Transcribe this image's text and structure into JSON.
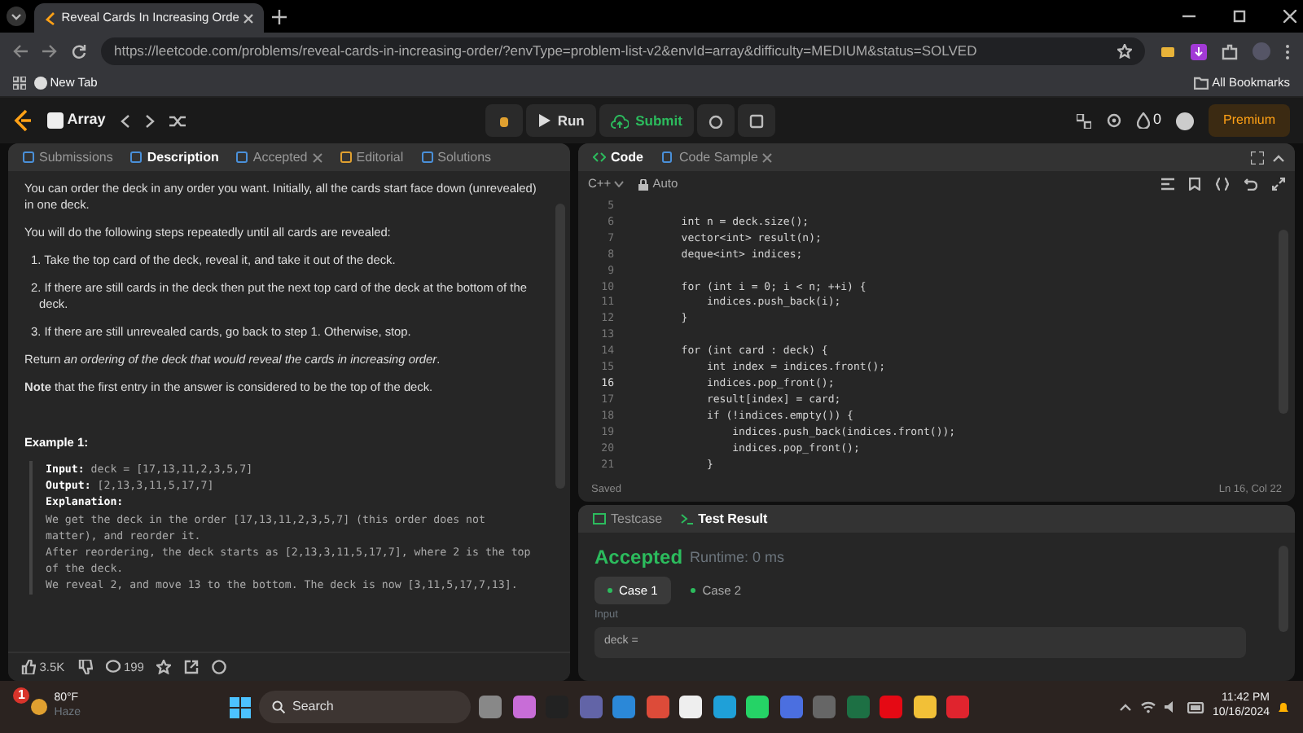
{
  "browser": {
    "tab_title": "Reveal Cards In Increasing Orde",
    "url": "https://leetcode.com/problems/reveal-cards-in-increasing-order/?envType=problem-list-v2&envId=array&difficulty=MEDIUM&status=SOLVED",
    "bookmarks": [
      "New Tab"
    ],
    "all_bookmarks": "All Bookmarks"
  },
  "header": {
    "problem_list": "Array",
    "run": "Run",
    "submit": "Submit",
    "streak": "0",
    "premium": "Premium"
  },
  "left_tabs": [
    {
      "label": "Submissions",
      "selected": false
    },
    {
      "label": "Description",
      "selected": true
    },
    {
      "label": "Accepted",
      "selected": false,
      "closable": true
    },
    {
      "label": "Editorial",
      "selected": false
    },
    {
      "label": "Solutions",
      "selected": false
    }
  ],
  "description": [
    {
      "kind": "p",
      "text": "You can order the deck in any order you want. Initially, all the cards start face down (unrevealed) in one deck."
    },
    {
      "kind": "p",
      "text": "You will do the following steps repeatedly until all cards are revealed:"
    },
    {
      "kind": "li",
      "text": "1. Take the top card of the deck, reveal it, and take it out of the deck."
    },
    {
      "kind": "li",
      "text": "2. If there are still cards in the deck then put the next top card of the deck at the bottom of the deck."
    },
    {
      "kind": "li",
      "text": "3. If there are still unrevealed cards, go back to step 1. Otherwise, stop."
    },
    {
      "kind": "p",
      "text": "Return *an ordering of the deck that would reveal the cards in increasing order*."
    },
    {
      "kind": "p",
      "text": "**Note** that the first entry in the answer is considered to be the top of the deck."
    }
  ],
  "example": {
    "title": "Example 1:",
    "lines": [
      "**Input:** deck = [17,13,11,2,3,5,7]",
      "**Output:** [2,13,3,11,5,17,7]",
      "**Explanation:**",
      "We get the deck in the order [17,13,11,2,3,5,7] (this order does not matter), and reorder it.",
      "After reordering, the deck starts as [2,13,3,11,5,17,7], where 2 is the top of the deck.",
      "We reveal 2, and move 13 to the bottom.  The deck is now [3,11,5,17,7,13]."
    ]
  },
  "left_footer": {
    "likes": "3.5K",
    "comments": "199"
  },
  "code_tabs": [
    {
      "label": "Code",
      "selected": true
    },
    {
      "label": "Code Sample",
      "selected": false,
      "closable": true
    }
  ],
  "editor": {
    "language": "C++",
    "mode": "Auto",
    "lines": [
      {
        "n": "5",
        "current": false
      },
      {
        "n": "6",
        "code": "        int n = deck.size();",
        "current": false
      },
      {
        "n": "7",
        "code": "        vector<int> result(n);",
        "current": false
      },
      {
        "n": "8",
        "code": "        deque<int> indices;",
        "current": false
      },
      {
        "n": "9",
        "current": false
      },
      {
        "n": "10",
        "code": "        for (int i = 0; i < n; ++i) {",
        "current": false
      },
      {
        "n": "11",
        "code": "            indices.push_back(i);",
        "current": false
      },
      {
        "n": "12",
        "code": "        }",
        "current": false
      },
      {
        "n": "13",
        "current": false
      },
      {
        "n": "14",
        "code": "        for (int card : deck) {",
        "current": false
      },
      {
        "n": "15",
        "code": "            int index = indices.front();",
        "current": false
      },
      {
        "n": "16",
        "code": "            indices.pop_front();",
        "current": true
      },
      {
        "n": "17",
        "code": "            result[index] = card;",
        "current": false
      },
      {
        "n": "18",
        "code": "            if (!indices.empty()) {",
        "current": false
      },
      {
        "n": "19",
        "code": "                indices.push_back(indices.front());",
        "current": false
      },
      {
        "n": "20",
        "code": "                indices.pop_front();",
        "current": false
      },
      {
        "n": "21",
        "code": "            }",
        "current": false
      }
    ],
    "status": "Saved",
    "cursor": "Ln 16, Col 22"
  },
  "bottom_tabs": [
    {
      "label": "Testcase",
      "selected": false
    },
    {
      "label": "Test Result",
      "selected": true
    }
  ],
  "result": {
    "verdict": "Accepted",
    "runtime": "Runtime: 0 ms",
    "cases": [
      {
        "label": "Case 1",
        "selected": true
      },
      {
        "label": "Case 2",
        "selected": false
      }
    ],
    "input_label": "Input",
    "input_value": "deck ="
  },
  "taskbar": {
    "notification_count": "1",
    "temperature": "80°F",
    "weather": "Haze",
    "search_placeholder": "Search",
    "time": "11:42 PM",
    "date": "10/16/2024"
  }
}
